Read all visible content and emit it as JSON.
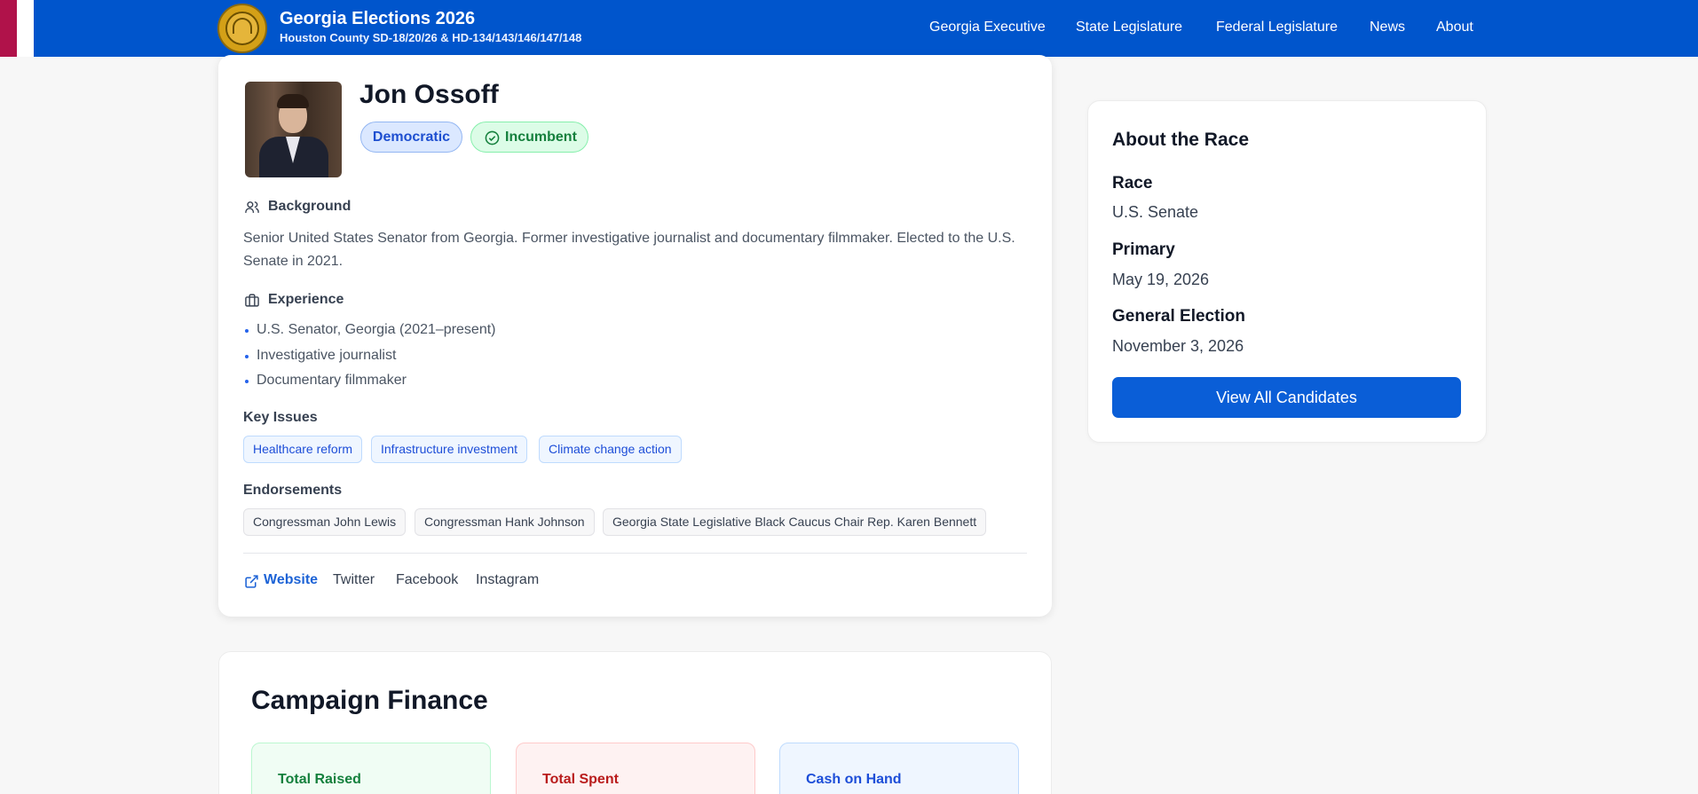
{
  "header": {
    "title": "Georgia Elections 2026",
    "subtitle": "Houston County SD-18/20/26 & HD-134/143/146/147/148",
    "nav": [
      "Georgia Executive",
      "State Legislature",
      "Federal Legislature",
      "News",
      "About"
    ]
  },
  "candidate": {
    "name": "Jon Ossoff",
    "party": "Democratic",
    "status": "Incumbent",
    "background_heading": "Background",
    "background": "Senior United States Senator from Georgia. Former investigative journalist and documentary filmmaker. Elected to the U.S. Senate in 2021.",
    "experience_heading": "Experience",
    "experience": [
      "U.S. Senator, Georgia (2021–present)",
      "Investigative journalist",
      "Documentary filmmaker"
    ],
    "issues_heading": "Key Issues",
    "issues": [
      "Healthcare reform",
      "Infrastructure investment",
      "Climate change action"
    ],
    "endorsements_heading": "Endorsements",
    "endorsements": [
      "Congressman John Lewis",
      "Congressman Hank Johnson",
      "Georgia State Legislative Black Caucus Chair Rep. Karen Bennett"
    ],
    "links": [
      "Website",
      "Twitter",
      "Facebook",
      "Instagram"
    ]
  },
  "finance": {
    "title": "Campaign Finance",
    "total_raised": "Total Raised",
    "total_spent": "Total Spent",
    "cash_on_hand": "Cash on Hand"
  },
  "race": {
    "title": "About the Race",
    "race_label": "Race",
    "race_value": "U.S. Senate",
    "primary_label": "Primary",
    "primary_value": "May 19, 2026",
    "general_label": "General Election",
    "general_value": "November 3, 2026",
    "button": "View All Candidates"
  },
  "colors": {
    "header": "#0055cc",
    "accent": "#0a5ed7",
    "democratic_badge": "#dbe8ff",
    "incumbent_badge": "#dcfce7"
  }
}
